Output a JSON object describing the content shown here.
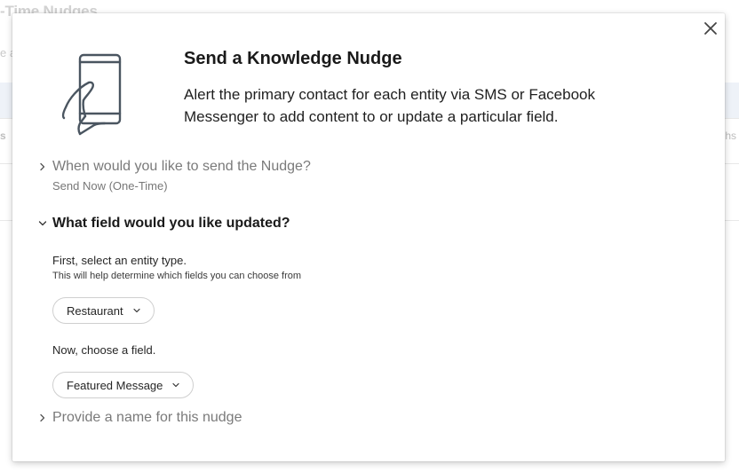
{
  "background": {
    "title_fragment": "-Time Nudges",
    "subtitle_fragment": "e a",
    "left_tab_fragment": "s",
    "right_tab_fragment": "hs"
  },
  "modal": {
    "title": "Send a Knowledge Nudge",
    "description": "Alert the primary contact for each entity via SMS or Facebook Messenger to add content to or update a particular field.",
    "close_icon": "close-icon",
    "illustration_icon": "phone-hand-icon"
  },
  "sections": {
    "when": {
      "label": "When would you like to send the Nudge?",
      "value": "Send Now (One-Time)",
      "expanded": false
    },
    "field": {
      "label": "What field would you like updated?",
      "expanded": true,
      "entity_prompt": "First, select an entity type.",
      "entity_hint": "This will help determine which fields you can choose from",
      "entity_selected": "Restaurant",
      "field_prompt": "Now, choose a field.",
      "field_selected": "Featured Message"
    },
    "name": {
      "label": "Provide a name for this nudge",
      "expanded": false
    }
  },
  "colors": {
    "text_primary": "#1a1a1a",
    "text_muted": "#7a7a7a",
    "icon_stroke": "#4a5560",
    "border": "#cfcfcf"
  }
}
